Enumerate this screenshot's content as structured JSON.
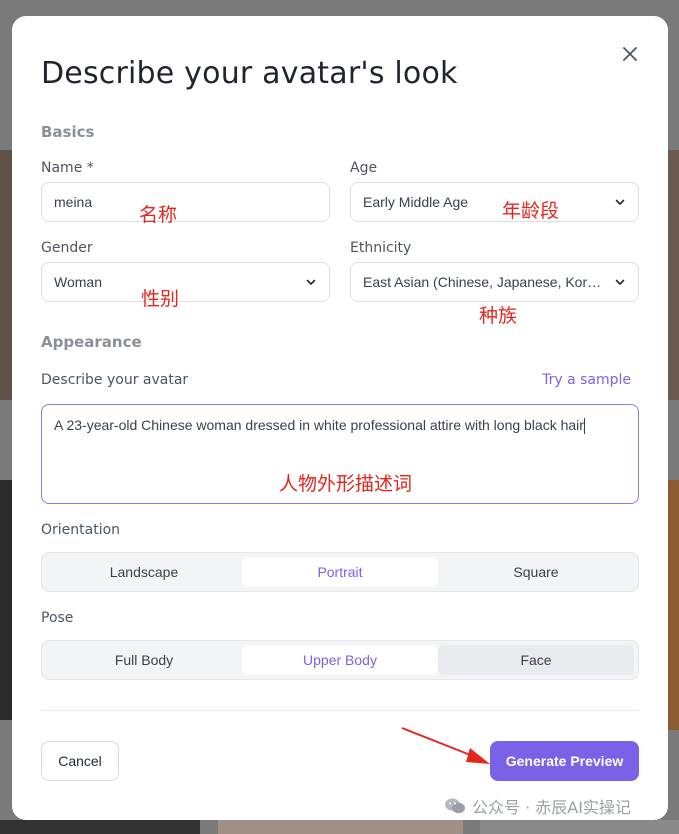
{
  "modal": {
    "title": "Describe your avatar's look",
    "close_icon": "close-icon"
  },
  "basics": {
    "section_title": "Basics",
    "name_label": "Name *",
    "name_value": "meina",
    "age_label": "Age",
    "age_value": "Early Middle Age",
    "gender_label": "Gender",
    "gender_value": "Woman",
    "ethnicity_label": "Ethnicity",
    "ethnicity_value": "East Asian (Chinese, Japanese, Korean)"
  },
  "appearance": {
    "section_title": "Appearance",
    "describe_label": "Describe your avatar",
    "try_sample": "Try a sample",
    "description": "A 23-year-old Chinese woman dressed in white professional attire with long black hair"
  },
  "orientation": {
    "label": "Orientation",
    "options": [
      "Landscape",
      "Portrait",
      "Square"
    ],
    "selected": "Portrait"
  },
  "pose": {
    "label": "Pose",
    "options": [
      "Full Body",
      "Upper Body",
      "Face"
    ],
    "selected": "Upper Body"
  },
  "footer": {
    "cancel_label": "Cancel",
    "generate_label": "Generate Preview"
  },
  "annotations": {
    "name": "名称",
    "age": "年龄段",
    "gender": "性别",
    "ethnicity": "种族",
    "description": "人物外形描述词"
  },
  "watermark": "公众号 · 赤辰AI实操记",
  "colors": {
    "accent": "#7b61e8",
    "annotation": "#e5261e",
    "overlay": "#7a7a7a"
  }
}
